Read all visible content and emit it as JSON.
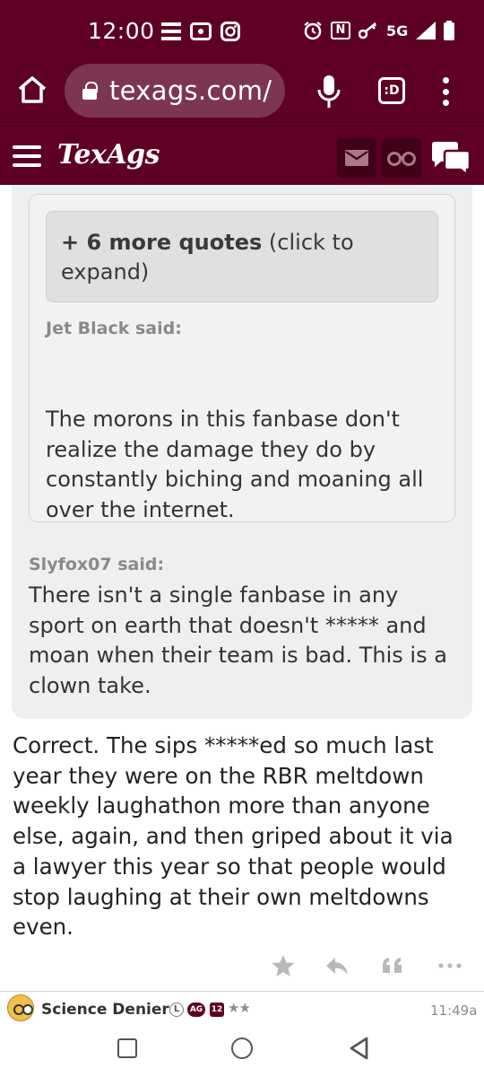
{
  "status_bar": {
    "time": "12:00",
    "network": "5G",
    "nfc": "N"
  },
  "browser": {
    "url": "texags.com/",
    "tabs_label": ":D"
  },
  "site": {
    "logo": "TexAgs"
  },
  "thread": {
    "more_quotes_bold": "+ 6 more quotes",
    "more_quotes_rest": "(click to expand)",
    "inner_quote": {
      "author_said": "Jet Black said:",
      "text": "The morons in this fanbase don't realize the damage they do by constantly biching and moaning all over the internet."
    },
    "outer_quote": {
      "author_said": "Slyfox07 said:",
      "text": "There isn't a single fanbase in any sport on earth that doesn't ***** and moan when their team is bad. This is a clown take."
    },
    "post_body": "Correct. The sips *****ed so much last year they were on the RBR meltdown weekly laughathon more than anyone else, again, and then griped about it via a lawyer this year so that people would stop laughing at their own meltdowns even.",
    "actions": {
      "star_icon": "star-icon",
      "reply_icon": "reply-icon",
      "quote_icon": "quote-icon",
      "more_icon": "more-icon"
    }
  },
  "next_post": {
    "username": "Science Denier",
    "badge_l": "L",
    "badge_ag": "AG",
    "badge_years": "12",
    "stars": "★★",
    "time": "11:49a"
  }
}
